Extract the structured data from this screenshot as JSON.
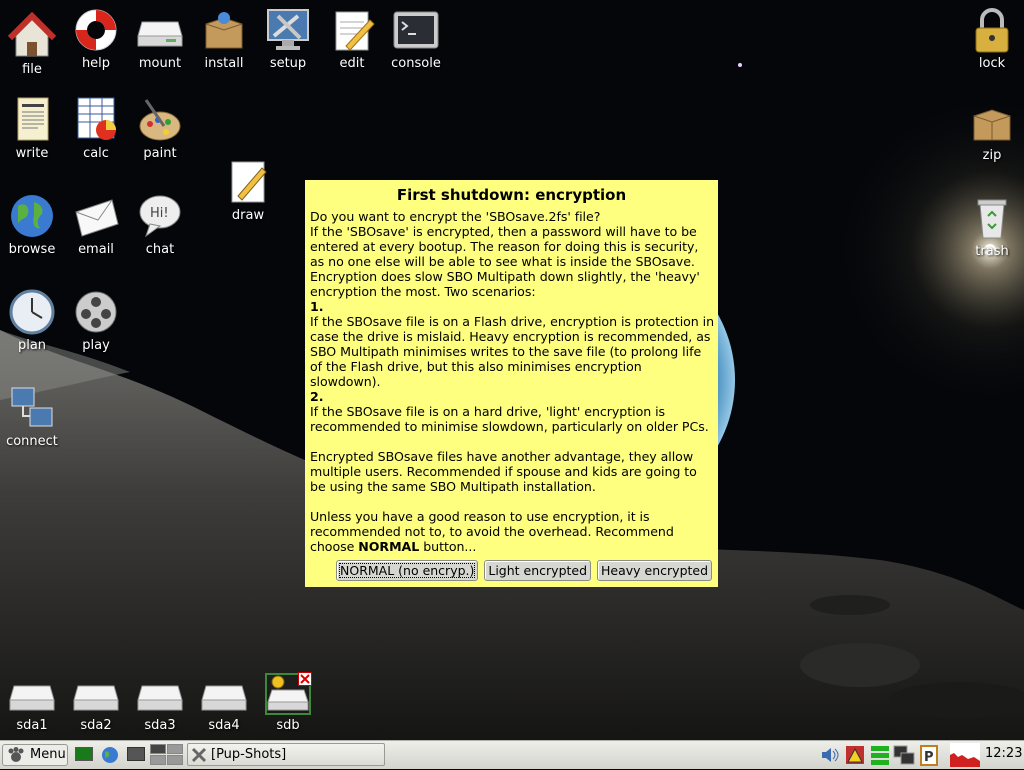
{
  "desktop": {
    "icons_left": [
      {
        "name": "file-icon",
        "label": "file"
      },
      {
        "name": "help-icon",
        "label": "help"
      },
      {
        "name": "mount-icon",
        "label": "mount"
      },
      {
        "name": "install-icon",
        "label": "install"
      },
      {
        "name": "setup-icon",
        "label": "setup"
      },
      {
        "name": "edit-icon",
        "label": "edit"
      },
      {
        "name": "console-icon",
        "label": "console"
      },
      {
        "name": "write-icon",
        "label": "write"
      },
      {
        "name": "calc-icon",
        "label": "calc"
      },
      {
        "name": "paint-icon",
        "label": "paint"
      },
      {
        "name": "draw-icon",
        "label": "draw"
      },
      {
        "name": "browse-icon",
        "label": "browse"
      },
      {
        "name": "email-icon",
        "label": "email"
      },
      {
        "name": "chat-icon",
        "label": "chat"
      },
      {
        "name": "plan-icon",
        "label": "plan"
      },
      {
        "name": "play-icon",
        "label": "play"
      },
      {
        "name": "connect-icon",
        "label": "connect"
      }
    ],
    "icons_right": [
      {
        "name": "lock-icon",
        "label": "lock"
      },
      {
        "name": "zip-icon",
        "label": "zip"
      },
      {
        "name": "trash-icon",
        "label": "trash"
      }
    ],
    "drives": [
      {
        "name": "drive-sda1-icon",
        "label": "sda1"
      },
      {
        "name": "drive-sda2-icon",
        "label": "sda2"
      },
      {
        "name": "drive-sda3-icon",
        "label": "sda3"
      },
      {
        "name": "drive-sda4-icon",
        "label": "sda4"
      },
      {
        "name": "drive-sdb-icon",
        "label": "sdb"
      }
    ]
  },
  "dialog": {
    "title": "First shutdown: encryption",
    "p1": "Do you want to encrypt the 'SBOsave.2fs' file?",
    "p2": "If the 'SBOsave' is encrypted, then a password will have to be entered at every bootup. The reason for doing this is security, as no one else will be able to see what is inside the SBOsave. Encryption does slow SBO Multipath down slightly, the 'heavy' encryption the most. Two scenarios:",
    "s1_num": "1.",
    "s1_text": "If the SBOsave file is on a Flash drive, encryption is protection in case the drive is mislaid. Heavy encryption is recommended, as SBO Multipath minimises writes to the save file (to prolong life of the Flash drive, but this also minimises encryption slowdown).",
    "s2_num": "2.",
    "s2_text": "If the SBOsave file is on a hard drive, 'light' encryption is recommended to minimise slowdown, particularly on older PCs.",
    "p3": "Encrypted SBOsave files have another advantage, they allow multiple users. Recommended if spouse and kids are going to be using the same SBO Multipath installation.",
    "p4_pre": "Unless you have a good reason to use encryption, it is recommended not to, to avoid the overhead. Recommend choose ",
    "p4_bold": "NORMAL",
    "p4_post": " button...",
    "buttons": {
      "normal": "NORMAL (no encryp.)",
      "light": "Light encrypted",
      "heavy": "Heavy encrypted"
    }
  },
  "taskbar": {
    "menu_label": "Menu",
    "task_label": "[Pup-Shots]",
    "clock": "12:23"
  }
}
